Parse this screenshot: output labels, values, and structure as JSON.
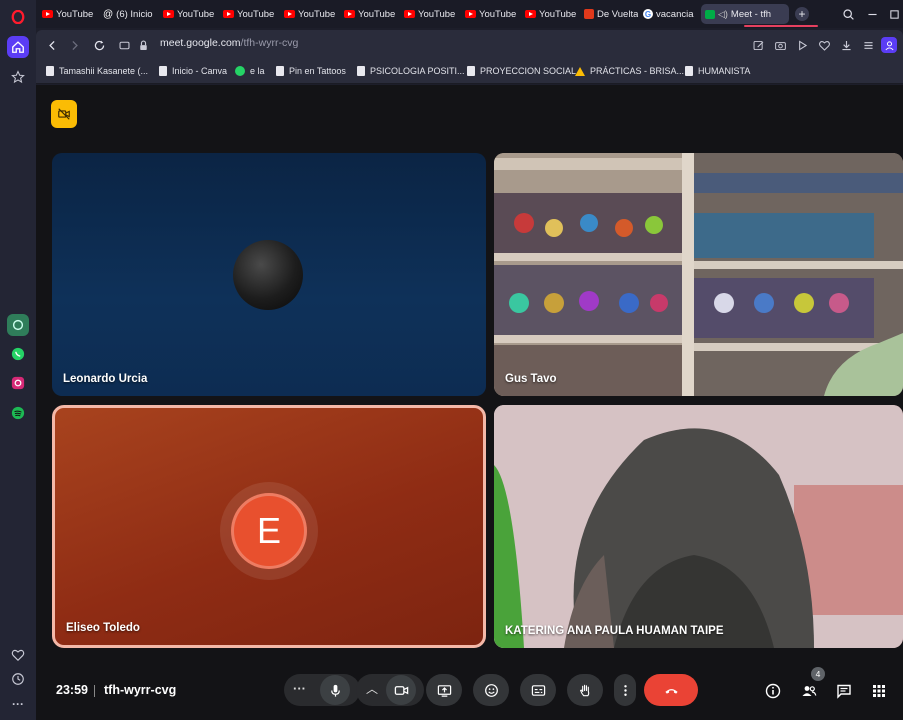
{
  "browser": {
    "tabs": [
      {
        "label": "YouTube",
        "icon": "youtube-icon"
      },
      {
        "label": "(6) Inicio",
        "icon": "threads-icon"
      },
      {
        "label": "YouTube",
        "icon": "youtube-icon"
      },
      {
        "label": "YouTube",
        "icon": "youtube-icon"
      },
      {
        "label": "YouTube",
        "icon": "youtube-icon"
      },
      {
        "label": "YouTube",
        "icon": "youtube-icon"
      },
      {
        "label": "YouTube",
        "icon": "youtube-icon"
      },
      {
        "label": "YouTube",
        "icon": "youtube-icon"
      },
      {
        "label": "YouTube",
        "icon": "youtube-icon"
      },
      {
        "label": "De Vuelta",
        "icon": "red-square-icon"
      },
      {
        "label": "vacancia",
        "icon": "google-icon"
      },
      {
        "label": "Meet - tfh",
        "icon": "meet-icon"
      }
    ],
    "url": {
      "host": "meet.google.com",
      "path": "/tfh-wyrr-cvg"
    },
    "bookmarks": [
      {
        "label": "Tamashii Kasanete (..."
      },
      {
        "label": "Inicio - Canva"
      },
      {
        "label": "e la"
      },
      {
        "label": "Pin en Tattoos"
      },
      {
        "label": "PSICOLOGIA POSITI..."
      },
      {
        "label": "PROYECCION SOCIAL"
      },
      {
        "label": "PRÁCTICAS - BRISA..."
      },
      {
        "label": "HUMANISTA"
      }
    ]
  },
  "meet": {
    "participants": [
      {
        "name": "Leonardo Urcia"
      },
      {
        "name": "Gus Tavo"
      },
      {
        "name": "Eliseo Toledo",
        "initial": "E"
      },
      {
        "name": "KATERING ANA PAULA HUAMAN TAIPE"
      }
    ],
    "time": "23:59",
    "meeting_code": "tfh-wyrr-cvg",
    "people_count": "4"
  },
  "colors": {
    "end_call": "#ea4335",
    "avatar_e": "#e8502e",
    "cam_off_badge": "#fbbc04",
    "active_speaker_border": "#f4b8a8"
  }
}
